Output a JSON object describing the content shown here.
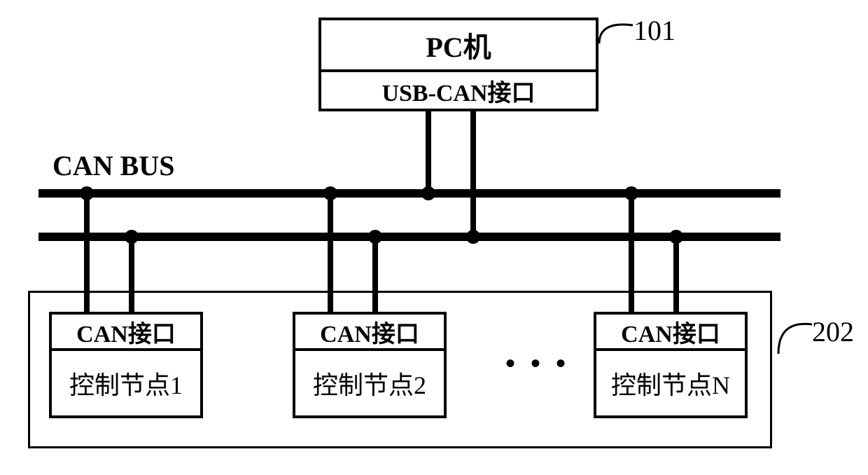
{
  "refs": {
    "pc": "101",
    "nodes": "202"
  },
  "pc": {
    "title": "PC机",
    "sub": "USB-CAN接口"
  },
  "bus": {
    "label": "CAN BUS"
  },
  "node": {
    "head": "CAN接口",
    "n1": "控制节点1",
    "n2": "控制节点2",
    "nN": "控制节点N"
  },
  "ellipsis": "• • •"
}
